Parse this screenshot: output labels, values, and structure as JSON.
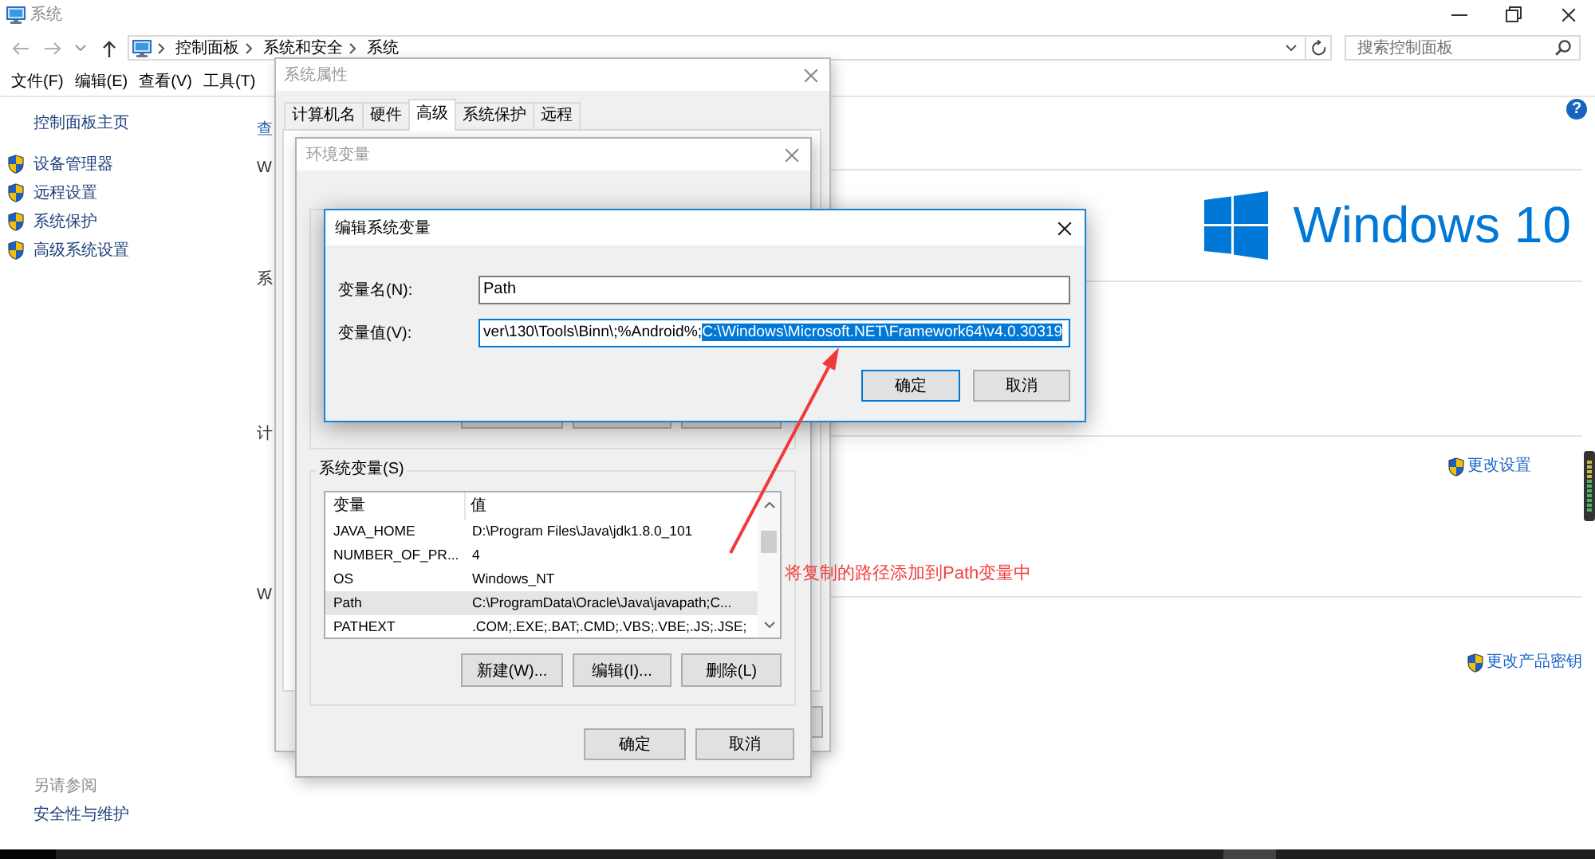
{
  "explorer": {
    "title": "系统",
    "breadcrumbs": [
      "控制面板",
      "系统和安全",
      "系统"
    ],
    "search": {
      "placeholder": "搜索控制面板"
    },
    "menu": [
      "文件(F)",
      "编辑(E)",
      "查看(V)",
      "工具(T)"
    ],
    "sidebar": {
      "home": "控制面板主页",
      "items": [
        "设备管理器",
        "远程设置",
        "系统保护",
        "高级系统设置"
      ],
      "see_also": {
        "title": "另请参阅",
        "links": [
          "安全性与维护"
        ]
      }
    },
    "content": {
      "title": "查",
      "help": "?",
      "sections": [
        {
          "heading": "W",
          "logo": "Windows 10"
        },
        {
          "heading": "系"
        },
        {
          "heading": "计",
          "link": "更改设置"
        },
        {
          "heading": "W",
          "link": "更改产品密钥"
        }
      ]
    }
  },
  "system_properties": {
    "title": "系统属性",
    "tabs": [
      {
        "label": "计算机名",
        "selected": false
      },
      {
        "label": "硬件",
        "selected": false
      },
      {
        "label": "高级",
        "selected": true
      },
      {
        "label": "系统保护",
        "selected": false
      },
      {
        "label": "远程",
        "selected": false
      }
    ]
  },
  "environment_variables": {
    "title": "环境变量",
    "system_variables": {
      "label": "系统变量(S)",
      "columns": [
        "变量",
        "值"
      ],
      "rows": [
        {
          "name": "JAVA_HOME",
          "value": "D:\\Program Files\\Java\\jdk1.8.0_101",
          "selected": false
        },
        {
          "name": "NUMBER_OF_PR...",
          "value": "4",
          "selected": false
        },
        {
          "name": "OS",
          "value": "Windows_NT",
          "selected": false
        },
        {
          "name": "Path",
          "value": "C:\\ProgramData\\Oracle\\Java\\javapath;C...",
          "selected": true
        },
        {
          "name": "PATHEXT",
          "value": ".COM;.EXE;.BAT;.CMD;.VBS;.VBE;.JS;.JSE;",
          "selected": false
        }
      ],
      "buttons": [
        "新建(W)...",
        "编辑(I)...",
        "删除(L)"
      ]
    },
    "buttons": [
      "确定",
      "取消"
    ]
  },
  "edit_variable": {
    "title": "编辑系统变量",
    "name_field": {
      "label": "变量名(N):",
      "value": "Path",
      "focused": false
    },
    "value_field": {
      "label": "变量值(V):",
      "focused": true,
      "value_parts": [
        {
          "text": "ver\\130\\Tools\\Binn\\;%Android%;",
          "selected": false
        },
        {
          "text": "C:\\Windows\\Microsoft.NET\\Framework64\\v4.0.30319",
          "selected": true
        }
      ]
    },
    "buttons": [
      {
        "label": "确定",
        "default": true
      },
      {
        "label": "取消",
        "default": false
      }
    ]
  },
  "annotation": {
    "text": "将复制的路径添加到Path变量中"
  }
}
